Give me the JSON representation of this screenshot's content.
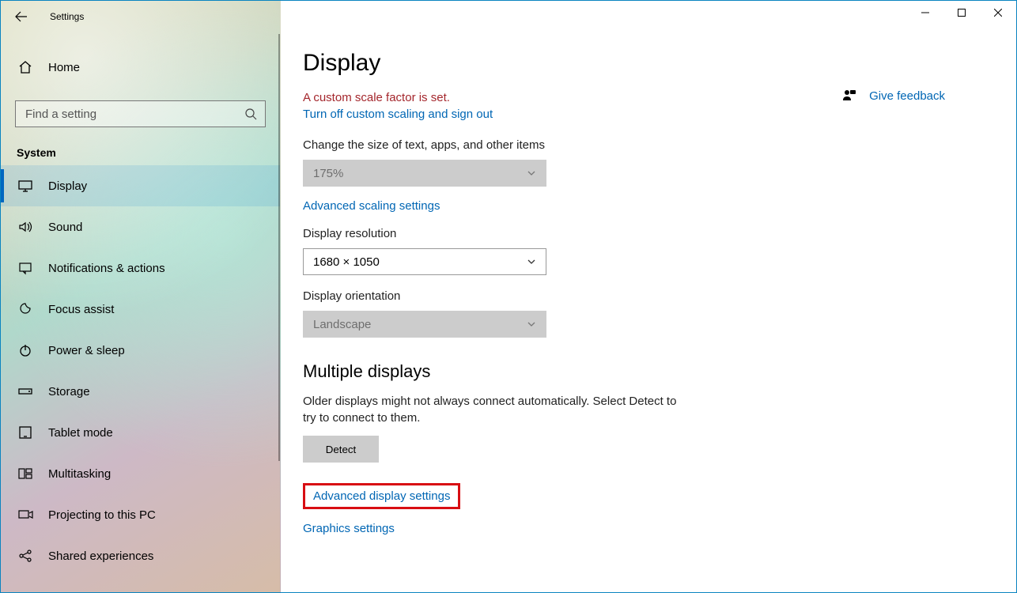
{
  "window": {
    "title": "Settings"
  },
  "sidebar": {
    "home": "Home",
    "search_placeholder": "Find a setting",
    "category": "System",
    "items": [
      {
        "label": "Display",
        "icon": "display-icon",
        "selected": true
      },
      {
        "label": "Sound",
        "icon": "sound-icon"
      },
      {
        "label": "Notifications & actions",
        "icon": "notifications-icon"
      },
      {
        "label": "Focus assist",
        "icon": "focus-assist-icon"
      },
      {
        "label": "Power & sleep",
        "icon": "power-icon"
      },
      {
        "label": "Storage",
        "icon": "storage-icon"
      },
      {
        "label": "Tablet mode",
        "icon": "tablet-icon"
      },
      {
        "label": "Multitasking",
        "icon": "multitasking-icon"
      },
      {
        "label": "Projecting to this PC",
        "icon": "projecting-icon"
      },
      {
        "label": "Shared experiences",
        "icon": "shared-icon"
      }
    ]
  },
  "page": {
    "heading": "Display",
    "scale_warning": "A custom scale factor is set.",
    "turn_off_link": "Turn off custom scaling and sign out",
    "scale_label": "Change the size of text, apps, and other items",
    "scale_value": "175%",
    "advanced_scaling_link": "Advanced scaling settings",
    "resolution_label": "Display resolution",
    "resolution_value": "1680 × 1050",
    "orientation_label": "Display orientation",
    "orientation_value": "Landscape",
    "multiple_heading": "Multiple displays",
    "multiple_desc": "Older displays might not always connect automatically. Select Detect to try to connect to them.",
    "detect_button": "Detect",
    "advanced_display_link": "Advanced display settings",
    "graphics_link": "Graphics settings",
    "feedback": "Give feedback"
  }
}
